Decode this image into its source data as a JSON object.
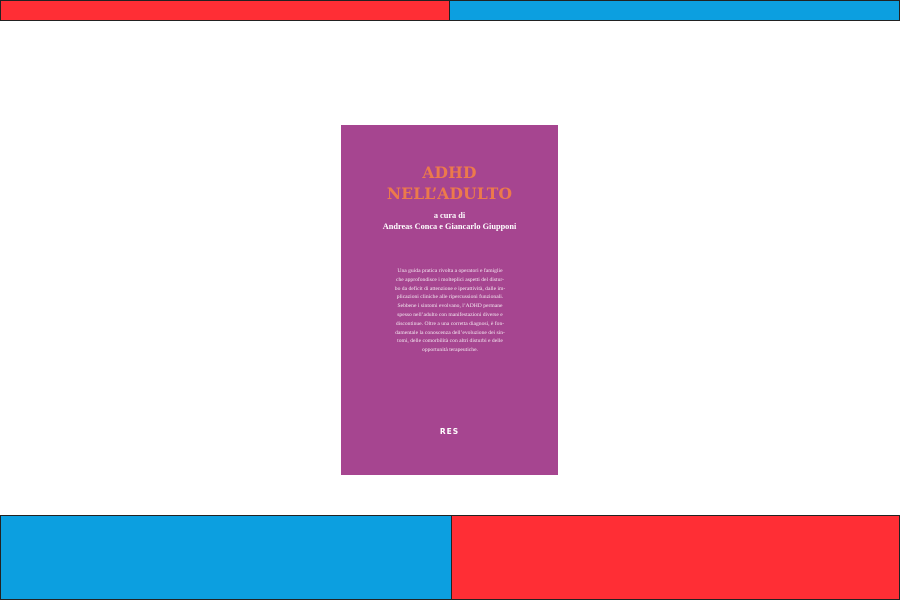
{
  "colors": {
    "red_band": "#ff2e35",
    "blue_band": "#0c9fe0",
    "cover_background": "#a64590",
    "title_color": "#ec7a4b"
  },
  "book": {
    "title_lines": [
      "ADHD",
      "NELL’ADULTO"
    ],
    "editor_prefix": "a cura di",
    "editors": "Andreas Conca e Giancarlo Giupponi",
    "blurb_lines": [
      "Una guida pratica rivolta a operatori e famiglie",
      "che approfondisce i molteplici aspetti del distur-",
      "bo da deficit di attenzione e iperattività, dalle im-",
      "plicazioni cliniche alle ripercussioni funzionali.",
      "Sebbene i sintomi evolvano, l’ADHD permane",
      "spesso nell’adulto con manifestazioni diverse e",
      "discontinue. Oltre a una corretta diagnosi, è fon-",
      "damentale la conoscenza dell’evoluzione dei sin-",
      "tomi, delle comorbilità con altri disturbi e delle",
      "opportunità terapeutiche."
    ],
    "publisher": "RES"
  }
}
